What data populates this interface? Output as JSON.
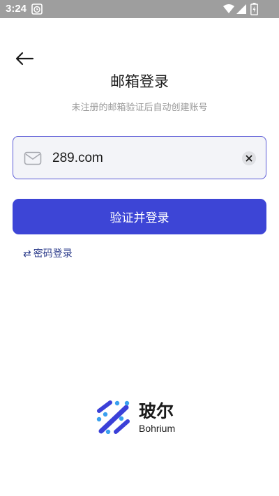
{
  "status_bar": {
    "time": "3:24"
  },
  "header": {
    "title": "邮箱登录",
    "subtitle": "未注册的邮箱验证后自动创建账号"
  },
  "email_input": {
    "value": "289.com",
    "placeholder": ""
  },
  "submit_button": {
    "label": "验证并登录"
  },
  "switch_login": {
    "arrows": "⇄",
    "label": "密码登录"
  },
  "brand": {
    "name_cn": "玻尔",
    "name_en": "Bohrium"
  },
  "colors": {
    "accent": "#3d45d6",
    "input_border": "#5b5bd6",
    "status_bar": "#9e9e9e",
    "logo_dark": "#3b40d8",
    "logo_light": "#3aa0ee"
  },
  "icons": [
    "alarm-icon",
    "wifi-icon",
    "cell-signal-icon",
    "battery-icon",
    "back-arrow-icon",
    "mail-icon",
    "clear-icon",
    "swap-icon",
    "bohrium-logo-icon"
  ]
}
